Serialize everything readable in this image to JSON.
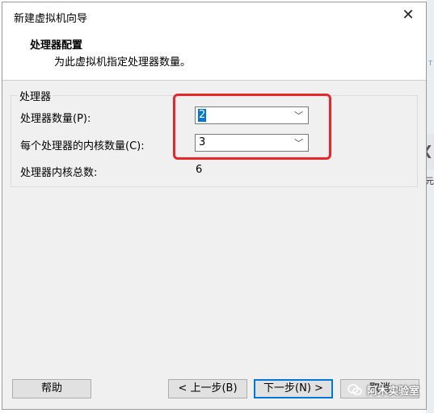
{
  "dialog": {
    "title": "新建虚拟机向导",
    "close_glyph": "✕"
  },
  "header": {
    "title": "处理器配置",
    "subtitle": "为此虚拟机指定处理器数量。"
  },
  "processors": {
    "group_label": "处理器",
    "count_label": "处理器数量(P):",
    "count_value": "2",
    "cores_label": "每个处理器的内核数量(C):",
    "cores_value": "3",
    "total_label": "处理器内核总数:",
    "total_value": "6"
  },
  "buttons": {
    "help": "帮助",
    "back": "< 上一步(B)",
    "next": "下一步(N) >",
    "cancel": "取消"
  },
  "watermark": "阿木实验室",
  "colors": {
    "highlight": "#e8262b",
    "accent": "#0078d7"
  }
}
